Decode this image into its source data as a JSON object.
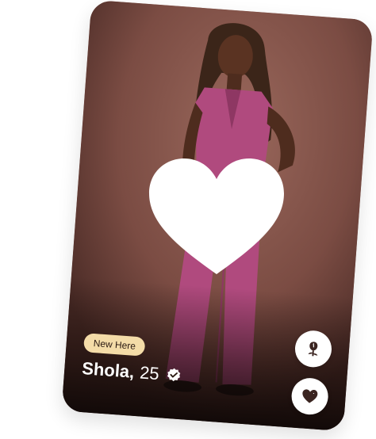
{
  "profile": {
    "badge": "New Here",
    "name": "Shola",
    "age": "25",
    "verified": true
  },
  "icons": {
    "verified": "verified-check-icon",
    "rose": "rose-icon",
    "favorite": "heart-icon",
    "overlay": "heart-icon"
  },
  "colors": {
    "badge_bg": "#f4dca8",
    "button_bg": "#ffffff",
    "icon_dark": "#3a2420"
  }
}
